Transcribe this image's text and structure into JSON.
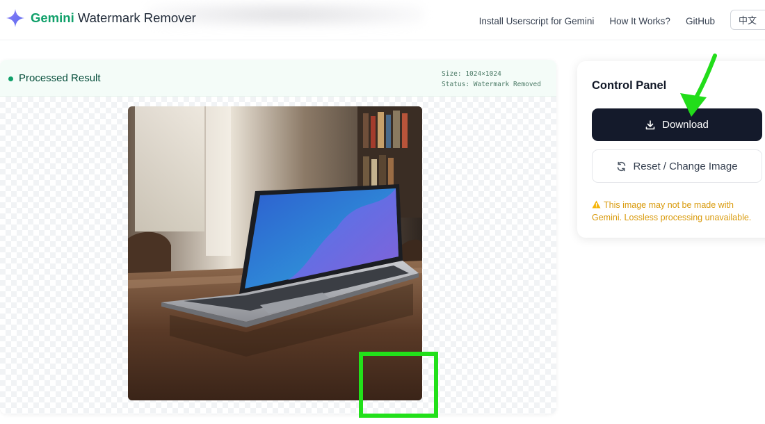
{
  "header": {
    "logo_accent": "Gemini",
    "logo_rest": " Watermark Remover",
    "nav": [
      "Install Userscript for Gemini",
      "How It Works?",
      "GitHub"
    ],
    "lang": "中文"
  },
  "result": {
    "title": "Processed Result",
    "size_text": "Size: 1024×1024",
    "status_text": "Status: Watermark Removed"
  },
  "panel": {
    "title": "Control Panel",
    "download_label": "Download",
    "reset_label": "Reset / Change Image",
    "warning": "This image may not be made with Gemini. Lossless processing unavailable."
  },
  "colors": {
    "accent": "#10a06a",
    "button_dark": "#141a2b",
    "warning": "#d99a0b",
    "highlight": "#22e01a"
  },
  "icons": [
    "gemini-sparkle-icon",
    "status-dot-icon",
    "download-icon",
    "refresh-icon",
    "warning-icon",
    "annotation-arrow-icon"
  ]
}
